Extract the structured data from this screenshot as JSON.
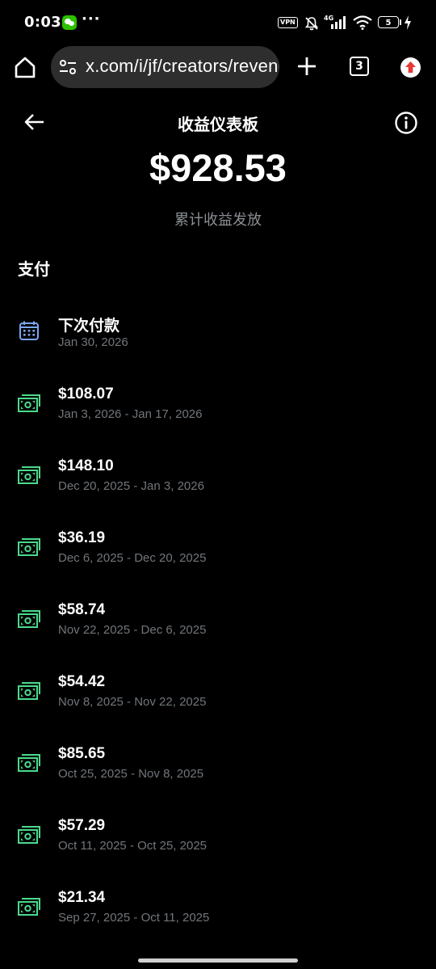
{
  "status_bar": {
    "time": "0:03",
    "dots": "···",
    "vpn": "VPN",
    "network": "4G",
    "battery": "5"
  },
  "browser": {
    "url": "x.com/i/jf/creators/revenue",
    "tab_count": "3",
    "icons": [
      "home-icon",
      "tune-icon",
      "plus-icon",
      "tabs-icon",
      "extension-icon"
    ]
  },
  "header": {
    "title": "收益仪表板",
    "total": "$928.53",
    "total_label": "累计收益发放"
  },
  "payments": {
    "section_title": "支付",
    "next": {
      "title": "下次付款",
      "date": "Jan 30, 2026"
    },
    "items": [
      {
        "amount": "$108.07",
        "period": "Jan 3, 2026 - Jan 17, 2026"
      },
      {
        "amount": "$148.10",
        "period": "Dec 20, 2025 - Jan 3, 2026"
      },
      {
        "amount": "$36.19",
        "period": "Dec 6, 2025 - Dec 20, 2025"
      },
      {
        "amount": "$58.74",
        "period": "Nov 22, 2025 - Dec 6, 2025"
      },
      {
        "amount": "$54.42",
        "period": "Nov 8, 2025 - Nov 22, 2025"
      },
      {
        "amount": "$85.65",
        "period": "Oct 25, 2025 - Nov 8, 2025"
      },
      {
        "amount": "$57.29",
        "period": "Oct 11, 2025 - Oct 25, 2025"
      },
      {
        "amount": "$21.34",
        "period": "Sep 27, 2025 - Oct 11, 2025"
      }
    ]
  },
  "colors": {
    "background": "#000000",
    "money_icon": "#4cd98b",
    "calendar_icon": "#7aa7f0",
    "secondary_text": "#71767b",
    "url_bar": "#2e2e2e"
  }
}
